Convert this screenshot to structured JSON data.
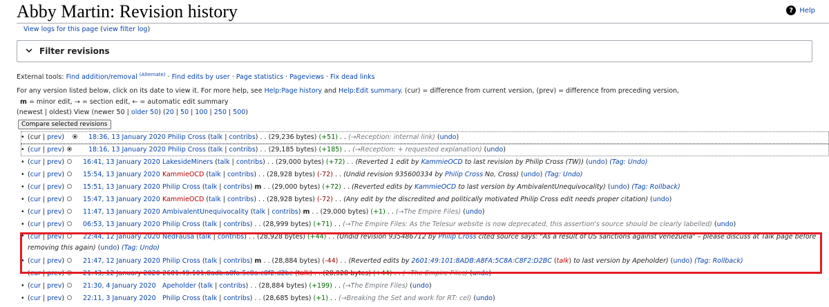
{
  "page": {
    "title": "Abby Martin: Revision history",
    "help_label": "Help",
    "logs_link": "View logs for this page",
    "filter_log_link": "view filter log"
  },
  "filter": {
    "label": "Filter revisions"
  },
  "external_tools": {
    "label": "External tools:",
    "tool1": "Find addition/removal",
    "tool1_sup": "(Alternate)",
    "tool2": "Find edits by user",
    "tool3": "Page statistics",
    "tool4": "Pageviews",
    "tool5": "Fix dead links"
  },
  "info": {
    "prefix": "For any version listed below, click on its date to view it. For more help, see",
    "help_link1": "Help:Page history",
    "and": "and",
    "help_link2": "Help:Edit summary",
    "suffix": ". (cur) = difference from current version, (prev) = difference from preceding version,",
    "minor_key": "m",
    "minor_text": "= minor edit,",
    "section_key": "→",
    "section_text": "= section edit,",
    "auto_key": "←",
    "auto_text": "= automatic edit summary"
  },
  "nav": {
    "newest": "newest",
    "oldest": "oldest",
    "view": "View (newer 50 |",
    "older": "older 50",
    "n20": "20",
    "n50": "50",
    "n100": "100",
    "n250": "250",
    "n500": "500"
  },
  "compare_button": "Compare selected revisions",
  "revisions": [
    {
      "cur": "cur",
      "prev": "prev",
      "date": "18:36, 13 January 2020",
      "user": "Philip Cross",
      "size": "(29,236 bytes)",
      "diff": "(+51)",
      "summary": "(→Reception: internal link)",
      "undo": "undo"
    },
    {
      "cur": "cur",
      "prev": "prev",
      "date": "18:16, 13 January 2020",
      "user": "Philip Cross",
      "size": "(29,185 bytes)",
      "diff": "(+185)",
      "summary": "(→Reception: + requested explanation)",
      "undo": "undo"
    },
    {
      "cur": "cur",
      "prev": "prev",
      "date": "16:41, 13 January 2020",
      "user": "LakesideMiners",
      "size": "(29,000 bytes)",
      "diff": "(+72)",
      "summary_a": "(Reverted 1 edit by",
      "summary_link": "KammieOCD",
      "summary_b": "to last revision by Philip Cross (TW))",
      "undo": "undo",
      "tag": "(Tag: Undo)"
    },
    {
      "cur": "cur",
      "prev": "prev",
      "date": "15:54, 13 January 2020",
      "user": "KammieOCD",
      "size": "(28,928 bytes)",
      "diff": "(-72)",
      "summary_a": "(Undid revision 935600334 by",
      "summary_link": "Philip Cross",
      "summary_b": "No, Cross)",
      "undo": "undo",
      "tag": "(Tag: Undo)"
    },
    {
      "cur": "cur",
      "prev": "prev",
      "date": "15:51, 13 January 2020",
      "user": "Philip Cross",
      "size": "(29,000 bytes)",
      "diff": "(+72)",
      "summary_a": "(Reverted edits by",
      "summary_link": "KammieOCD",
      "summary_b": "to last version by AmbivalentUnequivocality)",
      "undo": "undo",
      "tag": "(Tag: Rollback)"
    },
    {
      "cur": "cur",
      "prev": "prev",
      "date": "15:47, 13 January 2020",
      "user": "KammieOCD",
      "size": "(28,928 bytes)",
      "diff": "(-72)",
      "summary": "(Any edit by the discredited and politically motivated Philip Cross edit needs proper citation)",
      "undo": "undo"
    },
    {
      "cur": "cur",
      "prev": "prev",
      "date": "11:47, 13 January 2020",
      "user": "AmbivalentUnequivocality",
      "size": "(29,000 bytes)",
      "diff": "(+1)",
      "summary": "(→The Empire Files)",
      "undo": "undo"
    },
    {
      "cur": "cur",
      "prev": "prev",
      "date": "06:53, 13 January 2020",
      "user": "Philip Cross",
      "size": "(28,999 bytes)",
      "diff": "(+71)",
      "summary": "(→The Empire Files: As the Telesur website is now deprecated, this assertion's source should be clearly labelled)",
      "undo": "undo"
    },
    {
      "cur": "cur",
      "prev": "prev",
      "date": "22:44, 12 January 2020",
      "user": "NedFausa",
      "size": "(28,928 bytes)",
      "diff": "(+44)",
      "summary_a": "(Undid revision 935486712 by",
      "summary_link": "Philip Cross",
      "summary_b": "cited source says: \"As a result of US sanctions against Venezuela\" – please discuss at Talk page before removing this again)",
      "undo": "undo",
      "tag": "(Tag: Undo)"
    },
    {
      "cur": "cur",
      "prev": "prev",
      "date": "21:47, 12 January 2020",
      "user": "Philip Cross",
      "size": "(28,884 bytes)",
      "diff": "(-44)",
      "summary_a": "(Reverted edits by",
      "summary_link": "2601:49:101:8ADB:A8FA:5C8A:C8F2:D2BC",
      "summary_link2": "talk",
      "summary_b": "to last version by Apeholder)",
      "undo": "undo",
      "tag": "(Tag: Rollback)"
    },
    {
      "cur": "cur",
      "prev": "prev",
      "date": "21:43, 12 January 2020",
      "user": "2601:49:101:8adb:a8fa:5c8a:c8f2:d2bc",
      "size": "(28,928 bytes)",
      "diff": "(+44)",
      "summary": "(→The Empire Files)",
      "undo": "undo"
    },
    {
      "cur": "cur",
      "prev": "prev",
      "date": "21:30, 4 January 2020",
      "user": "Apeholder",
      "size": "(28,884 bytes)",
      "diff": "(+199)",
      "summary": "(→The Empire Files)",
      "undo": "undo"
    },
    {
      "cur": "cur",
      "prev": "prev",
      "date": "22:11, 3 January 2020",
      "user": "Philip Cross",
      "size": "(28,685 bytes)",
      "diff": "(+1)",
      "summary": "(→Breaking the Set and work for RT: cel)",
      "undo": "undo"
    }
  ],
  "common": {
    "talk": "talk",
    "contribs": "contribs",
    "minor": "m"
  },
  "colors": {
    "link": "#0645ad",
    "redlink": "#ba0000",
    "positive": "#006400",
    "negative": "#8b0000",
    "highlight": "#e41b23"
  }
}
